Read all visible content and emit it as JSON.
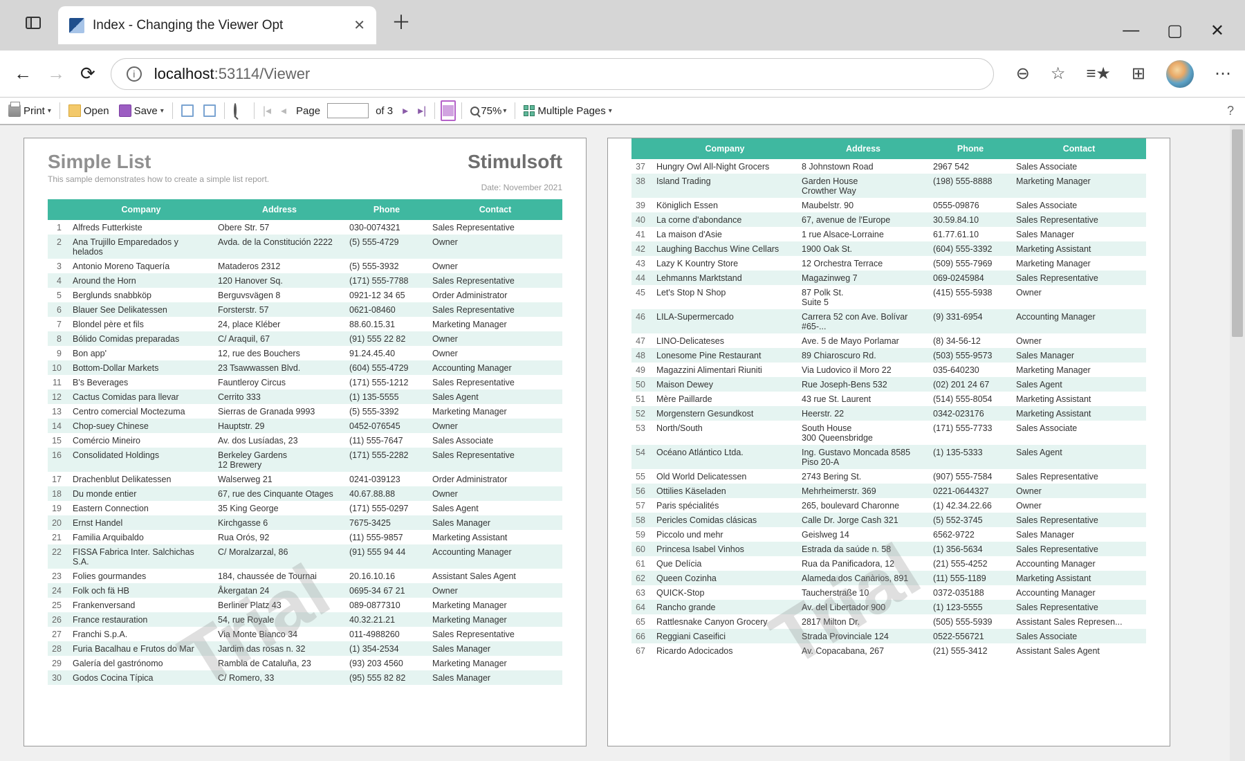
{
  "browser": {
    "tab_title": "Index - Changing the Viewer Opt",
    "url_host": "localhost",
    "url_port_path": ":53114/Viewer"
  },
  "toolbar": {
    "print": "Print",
    "open": "Open",
    "save": "Save",
    "page_label": "Page",
    "page_total": "of 3",
    "zoom": "75%",
    "multiple_pages": "Multiple Pages"
  },
  "report": {
    "title": "Simple List",
    "brand": "Stimulsoft",
    "subtitle": "This sample demonstrates how to create a simple list report.",
    "date": "Date: November 2021",
    "watermark": "Trial",
    "columns": {
      "company": "Company",
      "address": "Address",
      "phone": "Phone",
      "contact": "Contact"
    }
  },
  "rows_page1": [
    {
      "n": 1,
      "company": "Alfreds Futterkiste",
      "address": "Obere Str. 57",
      "phone": "030-0074321",
      "contact": "Sales Representative"
    },
    {
      "n": 2,
      "company": "Ana Trujillo Emparedados y helados",
      "address": "Avda. de la Constitución 2222",
      "phone": "(5) 555-4729",
      "contact": "Owner"
    },
    {
      "n": 3,
      "company": "Antonio Moreno Taquería",
      "address": "Mataderos  2312",
      "phone": "(5) 555-3932",
      "contact": "Owner"
    },
    {
      "n": 4,
      "company": "Around the Horn",
      "address": "120 Hanover Sq.",
      "phone": "(171) 555-7788",
      "contact": "Sales Representative"
    },
    {
      "n": 5,
      "company": "Berglunds snabbköp",
      "address": "Berguvsvägen  8",
      "phone": "0921-12 34 65",
      "contact": "Order Administrator"
    },
    {
      "n": 6,
      "company": "Blauer See Delikatessen",
      "address": "Forsterstr. 57",
      "phone": "0621-08460",
      "contact": "Sales Representative"
    },
    {
      "n": 7,
      "company": "Blondel père et fils",
      "address": "24, place Kléber",
      "phone": "88.60.15.31",
      "contact": "Marketing Manager"
    },
    {
      "n": 8,
      "company": "Bólido Comidas preparadas",
      "address": "C/ Araquil, 67",
      "phone": "(91) 555 22 82",
      "contact": "Owner"
    },
    {
      "n": 9,
      "company": "Bon app'",
      "address": "12, rue des Bouchers",
      "phone": "91.24.45.40",
      "contact": "Owner"
    },
    {
      "n": 10,
      "company": "Bottom-Dollar Markets",
      "address": "23 Tsawwassen Blvd.",
      "phone": "(604) 555-4729",
      "contact": "Accounting Manager"
    },
    {
      "n": 11,
      "company": "B's Beverages",
      "address": "Fauntleroy Circus",
      "phone": "(171) 555-1212",
      "contact": "Sales Representative"
    },
    {
      "n": 12,
      "company": "Cactus Comidas para llevar",
      "address": "Cerrito 333",
      "phone": "(1) 135-5555",
      "contact": "Sales Agent"
    },
    {
      "n": 13,
      "company": "Centro comercial Moctezuma",
      "address": "Sierras de Granada 9993",
      "phone": "(5) 555-3392",
      "contact": "Marketing Manager"
    },
    {
      "n": 14,
      "company": "Chop-suey Chinese",
      "address": "Hauptstr. 29",
      "phone": "0452-076545",
      "contact": "Owner"
    },
    {
      "n": 15,
      "company": "Comércio Mineiro",
      "address": "Av. dos Lusíadas, 23",
      "phone": "(11) 555-7647",
      "contact": "Sales Associate"
    },
    {
      "n": 16,
      "company": "Consolidated Holdings",
      "address": "Berkeley Gardens\n12  Brewery",
      "phone": "(171) 555-2282",
      "contact": "Sales Representative"
    },
    {
      "n": 17,
      "company": "Drachenblut Delikatessen",
      "address": "Walserweg 21",
      "phone": "0241-039123",
      "contact": "Order Administrator"
    },
    {
      "n": 18,
      "company": "Du monde entier",
      "address": "67, rue des Cinquante Otages",
      "phone": "40.67.88.88",
      "contact": "Owner"
    },
    {
      "n": 19,
      "company": "Eastern Connection",
      "address": "35 King George",
      "phone": "(171) 555-0297",
      "contact": "Sales Agent"
    },
    {
      "n": 20,
      "company": "Ernst Handel",
      "address": "Kirchgasse 6",
      "phone": "7675-3425",
      "contact": "Sales Manager"
    },
    {
      "n": 21,
      "company": "Familia Arquibaldo",
      "address": "Rua Orós, 92",
      "phone": "(11) 555-9857",
      "contact": "Marketing Assistant"
    },
    {
      "n": 22,
      "company": "FISSA Fabrica Inter. Salchichas S.A.",
      "address": "C/ Moralzarzal, 86",
      "phone": "(91) 555 94 44",
      "contact": "Accounting Manager"
    },
    {
      "n": 23,
      "company": "Folies gourmandes",
      "address": "184, chaussée de Tournai",
      "phone": "20.16.10.16",
      "contact": "Assistant Sales Agent"
    },
    {
      "n": 24,
      "company": "Folk och fä HB",
      "address": "Åkergatan 24",
      "phone": "0695-34 67 21",
      "contact": "Owner"
    },
    {
      "n": 25,
      "company": "Frankenversand",
      "address": "Berliner Platz 43",
      "phone": "089-0877310",
      "contact": "Marketing Manager"
    },
    {
      "n": 26,
      "company": "France restauration",
      "address": "54, rue Royale",
      "phone": "40.32.21.21",
      "contact": "Marketing Manager"
    },
    {
      "n": 27,
      "company": "Franchi S.p.A.",
      "address": "Via Monte Bianco 34",
      "phone": "011-4988260",
      "contact": "Sales Representative"
    },
    {
      "n": 28,
      "company": "Furia Bacalhau e Frutos do Mar",
      "address": "Jardim das rosas n. 32",
      "phone": "(1) 354-2534",
      "contact": "Sales Manager"
    },
    {
      "n": 29,
      "company": "Galería del gastrónomo",
      "address": "Rambla de Cataluña, 23",
      "phone": "(93) 203 4560",
      "contact": "Marketing Manager"
    },
    {
      "n": 30,
      "company": "Godos Cocina Típica",
      "address": "C/ Romero, 33",
      "phone": "(95) 555 82 82",
      "contact": "Sales Manager"
    }
  ],
  "rows_page2": [
    {
      "n": 37,
      "company": "Hungry Owl All-Night Grocers",
      "address": "8 Johnstown Road",
      "phone": "2967 542",
      "contact": "Sales Associate"
    },
    {
      "n": 38,
      "company": "Island Trading",
      "address": "Garden House\nCrowther Way",
      "phone": "(198) 555-8888",
      "contact": "Marketing Manager"
    },
    {
      "n": 39,
      "company": "Königlich Essen",
      "address": "Maubelstr. 90",
      "phone": "0555-09876",
      "contact": "Sales Associate"
    },
    {
      "n": 40,
      "company": "La corne d'abondance",
      "address": "67, avenue de l'Europe",
      "phone": "30.59.84.10",
      "contact": "Sales Representative"
    },
    {
      "n": 41,
      "company": "La maison d'Asie",
      "address": "1 rue Alsace-Lorraine",
      "phone": "61.77.61.10",
      "contact": "Sales Manager"
    },
    {
      "n": 42,
      "company": "Laughing Bacchus Wine Cellars",
      "address": "1900 Oak St.",
      "phone": "(604) 555-3392",
      "contact": "Marketing Assistant"
    },
    {
      "n": 43,
      "company": "Lazy K Kountry Store",
      "address": "12 Orchestra Terrace",
      "phone": "(509) 555-7969",
      "contact": "Marketing Manager"
    },
    {
      "n": 44,
      "company": "Lehmanns Marktstand",
      "address": "Magazinweg 7",
      "phone": "069-0245984",
      "contact": "Sales Representative"
    },
    {
      "n": 45,
      "company": "Let's Stop N Shop",
      "address": "87 Polk St.\nSuite 5",
      "phone": "(415) 555-5938",
      "contact": "Owner"
    },
    {
      "n": 46,
      "company": "LILA-Supermercado",
      "address": "Carrera 52 con Ave. Bolívar #65-...",
      "phone": "(9) 331-6954",
      "contact": "Accounting Manager"
    },
    {
      "n": 47,
      "company": "LINO-Delicateses",
      "address": "Ave. 5 de Mayo Porlamar",
      "phone": "(8) 34-56-12",
      "contact": "Owner"
    },
    {
      "n": 48,
      "company": "Lonesome Pine Restaurant",
      "address": "89 Chiaroscuro Rd.",
      "phone": "(503) 555-9573",
      "contact": "Sales Manager"
    },
    {
      "n": 49,
      "company": "Magazzini Alimentari Riuniti",
      "address": "Via Ludovico il Moro 22",
      "phone": "035-640230",
      "contact": "Marketing Manager"
    },
    {
      "n": 50,
      "company": "Maison Dewey",
      "address": "Rue Joseph-Bens 532",
      "phone": "(02) 201 24 67",
      "contact": "Sales Agent"
    },
    {
      "n": 51,
      "company": "Mère Paillarde",
      "address": "43 rue St. Laurent",
      "phone": "(514) 555-8054",
      "contact": "Marketing Assistant"
    },
    {
      "n": 52,
      "company": "Morgenstern Gesundkost",
      "address": "Heerstr. 22",
      "phone": "0342-023176",
      "contact": "Marketing Assistant"
    },
    {
      "n": 53,
      "company": "North/South",
      "address": "South House\n300 Queensbridge",
      "phone": "(171) 555-7733",
      "contact": "Sales Associate"
    },
    {
      "n": 54,
      "company": "Océano Atlántico Ltda.",
      "address": "Ing. Gustavo Moncada 8585\nPiso 20-A",
      "phone": "(1) 135-5333",
      "contact": "Sales Agent"
    },
    {
      "n": 55,
      "company": "Old World Delicatessen",
      "address": "2743 Bering St.",
      "phone": "(907) 555-7584",
      "contact": "Sales Representative"
    },
    {
      "n": 56,
      "company": "Ottilies Käseladen",
      "address": "Mehrheimerstr. 369",
      "phone": "0221-0644327",
      "contact": "Owner"
    },
    {
      "n": 57,
      "company": "Paris spécialités",
      "address": "265, boulevard Charonne",
      "phone": "(1) 42.34.22.66",
      "contact": "Owner"
    },
    {
      "n": 58,
      "company": "Pericles Comidas clásicas",
      "address": "Calle Dr. Jorge Cash 321",
      "phone": "(5) 552-3745",
      "contact": "Sales Representative"
    },
    {
      "n": 59,
      "company": "Piccolo und mehr",
      "address": "Geislweg 14",
      "phone": "6562-9722",
      "contact": "Sales Manager"
    },
    {
      "n": 60,
      "company": "Princesa Isabel Vinhos",
      "address": "Estrada da saúde n. 58",
      "phone": "(1) 356-5634",
      "contact": "Sales Representative"
    },
    {
      "n": 61,
      "company": "Que Delícia",
      "address": "Rua da Panificadora, 12",
      "phone": "(21) 555-4252",
      "contact": "Accounting Manager"
    },
    {
      "n": 62,
      "company": "Queen Cozinha",
      "address": "Alameda dos Canàrios, 891",
      "phone": "(11) 555-1189",
      "contact": "Marketing Assistant"
    },
    {
      "n": 63,
      "company": "QUICK-Stop",
      "address": "Taucherstraße 10",
      "phone": "0372-035188",
      "contact": "Accounting Manager"
    },
    {
      "n": 64,
      "company": "Rancho grande",
      "address": "Av. del Libertador 900",
      "phone": "(1) 123-5555",
      "contact": "Sales Representative"
    },
    {
      "n": 65,
      "company": "Rattlesnake Canyon Grocery",
      "address": "2817 Milton Dr.",
      "phone": "(505) 555-5939",
      "contact": "Assistant Sales Represen..."
    },
    {
      "n": 66,
      "company": "Reggiani Caseifici",
      "address": "Strada Provinciale 124",
      "phone": "0522-556721",
      "contact": "Sales Associate"
    },
    {
      "n": 67,
      "company": "Ricardo Adocicados",
      "address": "Av. Copacabana, 267",
      "phone": "(21) 555-3412",
      "contact": "Assistant Sales Agent"
    }
  ]
}
